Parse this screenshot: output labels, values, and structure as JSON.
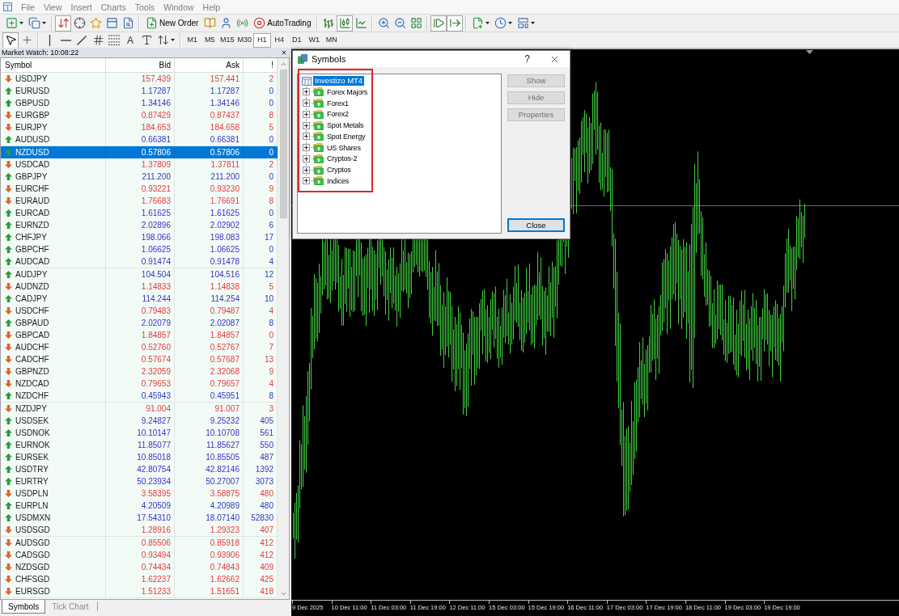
{
  "menu_bar": [
    {
      "label": "File",
      "disabled": true
    },
    {
      "label": "View",
      "disabled": true
    },
    {
      "label": "Insert",
      "disabled": true
    },
    {
      "label": "Charts",
      "disabled": true
    },
    {
      "label": "Tools",
      "disabled": true
    },
    {
      "label": "Window",
      "disabled": true
    },
    {
      "label": "Help",
      "disabled": true
    }
  ],
  "toolbar_1": {
    "groups": [
      {
        "items": [
          {
            "kind": "icon",
            "pressed": false,
            "dropdown": true
          },
          {
            "kind": "icon",
            "pressed": false,
            "dropdown": true
          }
        ]
      },
      {
        "items": [
          {
            "kind": "icon",
            "pressed": true,
            "dropdown": false
          },
          {
            "kind": "icon",
            "pressed": false,
            "dropdown": false
          },
          {
            "kind": "icon",
            "pressed": false,
            "dropdown": false
          },
          {
            "kind": "icon",
            "pressed": false,
            "dropdown": false
          },
          {
            "kind": "icon",
            "pressed": false,
            "dropdown": false
          }
        ]
      },
      {
        "items": [
          {
            "kind": "button",
            "label": "New Order",
            "pressed": false
          },
          {
            "kind": "icon",
            "pressed": false,
            "dropdown": false
          },
          {
            "kind": "icon",
            "pressed": false,
            "dropdown": false
          },
          {
            "kind": "icon",
            "pressed": false,
            "dropdown": false
          },
          {
            "kind": "button",
            "label": "AutoTrading",
            "pressed": false
          }
        ]
      },
      {
        "items": [
          {
            "kind": "icon",
            "pressed": false,
            "dropdown": false
          },
          {
            "kind": "icon",
            "pressed": true,
            "dropdown": false
          },
          {
            "kind": "icon",
            "pressed": false,
            "dropdown": false
          }
        ]
      },
      {
        "items": [
          {
            "kind": "icon",
            "pressed": false,
            "dropdown": false
          },
          {
            "kind": "icon",
            "pressed": false,
            "dropdown": false
          },
          {
            "kind": "icon",
            "pressed": false,
            "dropdown": false
          }
        ]
      },
      {
        "items": [
          {
            "kind": "icon",
            "pressed": true,
            "dropdown": false
          },
          {
            "kind": "icon",
            "pressed": true,
            "dropdown": false
          }
        ]
      },
      {
        "items": [
          {
            "kind": "icon",
            "pressed": false,
            "dropdown": true
          },
          {
            "kind": "icon",
            "pressed": false,
            "dropdown": true
          },
          {
            "kind": "icon",
            "pressed": false,
            "dropdown": true
          }
        ]
      }
    ]
  },
  "toolbar_2": {
    "groups": [
      {
        "items": [
          {
            "kind": "icon",
            "pressed": true,
            "dropdown": false
          },
          {
            "kind": "icon",
            "pressed": false,
            "dropdown": false
          }
        ]
      },
      {
        "items": [
          {
            "kind": "icon",
            "pressed": false,
            "dropdown": false
          },
          {
            "kind": "icon",
            "pressed": false,
            "dropdown": false
          },
          {
            "kind": "icon",
            "pressed": false,
            "dropdown": false
          },
          {
            "kind": "icon",
            "pressed": false,
            "dropdown": false
          },
          {
            "kind": "icon",
            "pressed": false,
            "dropdown": false
          },
          {
            "kind": "text",
            "label": "A",
            "pressed": false
          },
          {
            "kind": "icon",
            "pressed": false,
            "dropdown": false
          },
          {
            "kind": "icon",
            "pressed": false,
            "dropdown": true
          }
        ]
      }
    ]
  },
  "timeframes": [
    {
      "label": "M1",
      "selected": false
    },
    {
      "label": "M5",
      "selected": false
    },
    {
      "label": "M15",
      "selected": false
    },
    {
      "label": "M30",
      "selected": false
    },
    {
      "label": "H1",
      "selected": true
    },
    {
      "label": "H4",
      "selected": false
    },
    {
      "label": "D1",
      "selected": false
    },
    {
      "label": "W1",
      "selected": false
    },
    {
      "label": "MN",
      "selected": false
    }
  ],
  "market_watch": {
    "title": "Market Watch: 10:08:22",
    "columns": [
      "Symbol",
      "Bid",
      "Ask",
      "!"
    ],
    "rows": [
      {
        "symbol": "USDJPY",
        "bid": "157.439",
        "ask": "157.441",
        "spread": "2",
        "kind": "down",
        "selected": false
      },
      {
        "symbol": "EURUSD",
        "bid": "1.17287",
        "ask": "1.17287",
        "spread": "0",
        "kind": "up",
        "selected": false
      },
      {
        "symbol": "GBPUSD",
        "bid": "1.34146",
        "ask": "1.34146",
        "spread": "0",
        "kind": "up",
        "selected": false
      },
      {
        "symbol": "EURGBP",
        "bid": "0.87429",
        "ask": "0.87437",
        "spread": "8",
        "kind": "down",
        "selected": false
      },
      {
        "symbol": "EURJPY",
        "bid": "184.653",
        "ask": "184.658",
        "spread": "5",
        "kind": "down",
        "selected": false
      },
      {
        "symbol": "AUDUSD",
        "bid": "0.66381",
        "ask": "0.66381",
        "spread": "0",
        "kind": "up",
        "selected": false
      },
      {
        "symbol": "NZDUSD",
        "bid": "0.57806",
        "ask": "0.57806",
        "spread": "0",
        "kind": "up",
        "selected": true
      },
      {
        "symbol": "USDCAD",
        "bid": "1.37809",
        "ask": "1.37811",
        "spread": "2",
        "kind": "down",
        "selected": false
      },
      {
        "symbol": "GBPJPY",
        "bid": "211.200",
        "ask": "211.200",
        "spread": "0",
        "kind": "up",
        "selected": false
      },
      {
        "symbol": "EURCHF",
        "bid": "0.93221",
        "ask": "0.93230",
        "spread": "9",
        "kind": "down",
        "selected": false
      },
      {
        "symbol": "EURAUD",
        "bid": "1.76683",
        "ask": "1.76691",
        "spread": "8",
        "kind": "down",
        "selected": false
      },
      {
        "symbol": "EURCAD",
        "bid": "1.61625",
        "ask": "1.61625",
        "spread": "0",
        "kind": "up",
        "selected": false
      },
      {
        "symbol": "EURNZD",
        "bid": "2.02896",
        "ask": "2.02902",
        "spread": "6",
        "kind": "up",
        "selected": false
      },
      {
        "symbol": "CHFJPY",
        "bid": "198.066",
        "ask": "198.083",
        "spread": "17",
        "kind": "up",
        "selected": false
      },
      {
        "symbol": "GBPCHF",
        "bid": "1.06625",
        "ask": "1.06625",
        "spread": "0",
        "kind": "up",
        "selected": false
      },
      {
        "symbol": "AUDCAD",
        "bid": "0.91474",
        "ask": "0.91478",
        "spread": "4",
        "kind": "up",
        "selected": false
      },
      {
        "symbol": "AUDJPY",
        "bid": "104.504",
        "ask": "104.516",
        "spread": "12",
        "kind": "up",
        "selected": false
      },
      {
        "symbol": "AUDNZD",
        "bid": "1.14833",
        "ask": "1.14838",
        "spread": "5",
        "kind": "down",
        "selected": false
      },
      {
        "symbol": "CADJPY",
        "bid": "114.244",
        "ask": "114.254",
        "spread": "10",
        "kind": "up",
        "selected": false
      },
      {
        "symbol": "USDCHF",
        "bid": "0.79483",
        "ask": "0.79487",
        "spread": "4",
        "kind": "down",
        "selected": false
      },
      {
        "symbol": "GBPAUD",
        "bid": "2.02079",
        "ask": "2.02087",
        "spread": "8",
        "kind": "up",
        "selected": false
      },
      {
        "symbol": "GBPCAD",
        "bid": "1.84857",
        "ask": "1.84857",
        "spread": "0",
        "kind": "down",
        "selected": false
      },
      {
        "symbol": "AUDCHF",
        "bid": "0.52760",
        "ask": "0.52767",
        "spread": "7",
        "kind": "down",
        "selected": false
      },
      {
        "symbol": "CADCHF",
        "bid": "0.57674",
        "ask": "0.57687",
        "spread": "13",
        "kind": "down",
        "selected": false
      },
      {
        "symbol": "GBPNZD",
        "bid": "2.32059",
        "ask": "2.32068",
        "spread": "9",
        "kind": "down",
        "selected": false
      },
      {
        "symbol": "NZDCAD",
        "bid": "0.79653",
        "ask": "0.79657",
        "spread": "4",
        "kind": "down",
        "selected": false
      },
      {
        "symbol": "NZDCHF",
        "bid": "0.45943",
        "ask": "0.45951",
        "spread": "8",
        "kind": "up",
        "selected": false
      },
      {
        "symbol": "NZDJPY",
        "bid": "91.004",
        "ask": "91.007",
        "spread": "3",
        "kind": "down",
        "selected": false
      },
      {
        "symbol": "USDSEK",
        "bid": "9.24827",
        "ask": "9.25232",
        "spread": "405",
        "kind": "up",
        "selected": false
      },
      {
        "symbol": "USDNOK",
        "bid": "10.10147",
        "ask": "10.10708",
        "spread": "561",
        "kind": "up",
        "selected": false
      },
      {
        "symbol": "EURNOK",
        "bid": "11.85077",
        "ask": "11.85627",
        "spread": "550",
        "kind": "up",
        "selected": false
      },
      {
        "symbol": "EURSEK",
        "bid": "10.85018",
        "ask": "10.85505",
        "spread": "487",
        "kind": "up",
        "selected": false
      },
      {
        "symbol": "USDTRY",
        "bid": "42.80754",
        "ask": "42.82146",
        "spread": "1392",
        "kind": "up",
        "selected": false
      },
      {
        "symbol": "EURTRY",
        "bid": "50.23934",
        "ask": "50.27007",
        "spread": "3073",
        "kind": "up",
        "selected": false
      },
      {
        "symbol": "USDPLN",
        "bid": "3.58395",
        "ask": "3.58875",
        "spread": "480",
        "kind": "down",
        "selected": false
      },
      {
        "symbol": "EURPLN",
        "bid": "4.20509",
        "ask": "4.20989",
        "spread": "480",
        "kind": "up",
        "selected": false
      },
      {
        "symbol": "USDMXN",
        "bid": "17.54310",
        "ask": "18.07140",
        "spread": "52830",
        "kind": "up",
        "selected": false
      },
      {
        "symbol": "USDSGD",
        "bid": "1.28916",
        "ask": "1.29323",
        "spread": "407",
        "kind": "down",
        "selected": false
      },
      {
        "symbol": "AUDSGD",
        "bid": "0.85506",
        "ask": "0.85918",
        "spread": "412",
        "kind": "down",
        "selected": false
      },
      {
        "symbol": "CADSGD",
        "bid": "0.93494",
        "ask": "0.93906",
        "spread": "412",
        "kind": "down",
        "selected": false
      },
      {
        "symbol": "NZDSGD",
        "bid": "0.74434",
        "ask": "0.74843",
        "spread": "409",
        "kind": "down",
        "selected": false
      },
      {
        "symbol": "CHFSGD",
        "bid": "1.62237",
        "ask": "1.62662",
        "spread": "425",
        "kind": "down",
        "selected": false
      },
      {
        "symbol": "EURSGD",
        "bid": "1.51233",
        "ask": "1.51651",
        "spread": "418",
        "kind": "down",
        "selected": false
      }
    ],
    "tabs": [
      {
        "label": "Symbols",
        "selected": true
      },
      {
        "label": "Tick Chart",
        "selected": false
      }
    ]
  },
  "chart": {
    "time_axis": [
      "9 Dec 2025",
      "10 Dec 11:00",
      "11 Dec 03:00",
      "11 Dec 19:00",
      "12 Dec 11:00",
      "15 Dec 03:00",
      "15 Dec 19:00",
      "16 Dec 11:00",
      "17 Dec 03:00",
      "17 Dec 19:00",
      "18 Dec 11:00",
      "19 Dec 03:00",
      "19 Dec 19:00"
    ]
  },
  "symbols_dialog": {
    "title": "Symbols",
    "help": "?",
    "tree": {
      "highlighted": true,
      "root": {
        "label": "Investizo MT4",
        "selected": true,
        "expanded": true,
        "children": [
          {
            "label": "Forex Majors",
            "selected": false,
            "expanded": false
          },
          {
            "label": "Forex1",
            "selected": false,
            "expanded": false
          },
          {
            "label": "Forex2",
            "selected": false,
            "expanded": false
          },
          {
            "label": "Spot Metals",
            "selected": false,
            "expanded": false
          },
          {
            "label": "Spot Energy",
            "selected": false,
            "expanded": false
          },
          {
            "label": "US Shares",
            "selected": false,
            "expanded": false
          },
          {
            "label": "Cryptos-2",
            "selected": false,
            "expanded": false
          },
          {
            "label": "Cryptos",
            "selected": false,
            "expanded": false
          },
          {
            "label": "Indices",
            "selected": false,
            "expanded": false
          }
        ]
      }
    },
    "buttons": [
      {
        "label": "Show",
        "disabled": true
      },
      {
        "label": "Hide",
        "disabled": true
      },
      {
        "label": "Properties",
        "disabled": true
      }
    ],
    "close_button": {
      "label": "Close",
      "default": true
    }
  }
}
